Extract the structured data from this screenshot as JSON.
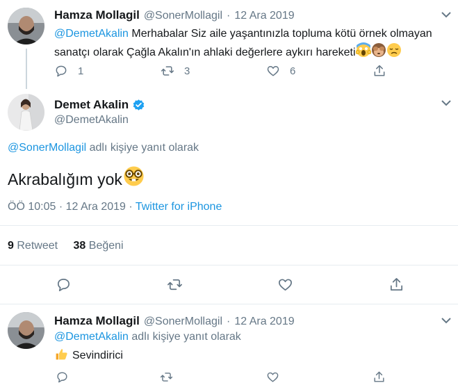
{
  "parent_tweet": {
    "name": "Hamza Mollagil",
    "handle": "@SonerMollagil",
    "separator": "·",
    "date": "12 Ara 2019",
    "mention": "@DemetAkalin",
    "text": " Merhabalar Siz aile yaşantınızla topluma kötü örnek olmayan sanatçı olarak Çağla Akalın'ın ahlaki değerlere aykırı hareketi",
    "emojis": [
      "screaming-face",
      "see-no-evil-monkey",
      "disappointed-face"
    ],
    "reply_count": "1",
    "retweet_count": "3",
    "like_count": "6"
  },
  "main_tweet": {
    "name": "Demet Akalin",
    "verified": true,
    "handle": "@DemetAkalin",
    "reply_to_mention": "@SonerMollagil",
    "reply_to_suffix": " adlı kişiye yanıt olarak",
    "text": "Akrabalığım yok",
    "emoji": "nerd-face",
    "time": "ÖÖ 10:05",
    "separator": "·",
    "date": "12 Ara 2019",
    "source": "Twitter for iPhone",
    "retweets_count": "9",
    "retweets_label": "Retweet",
    "likes_count": "38",
    "likes_label": "Beğeni"
  },
  "reply_tweet": {
    "name": "Hamza Mollagil",
    "handle": "@SonerMollagil",
    "separator": "·",
    "date": "12 Ara 2019",
    "reply_to_mention": "@DemetAkalin",
    "reply_to_suffix": " adlı kişiye yanıt olarak",
    "emoji": "thumbs-up",
    "text": "Sevindirici"
  },
  "colors": {
    "accent": "#1b95e0",
    "secondary_text": "#657786",
    "divider": "#e6ecf0",
    "verified": "#1da1f2"
  }
}
